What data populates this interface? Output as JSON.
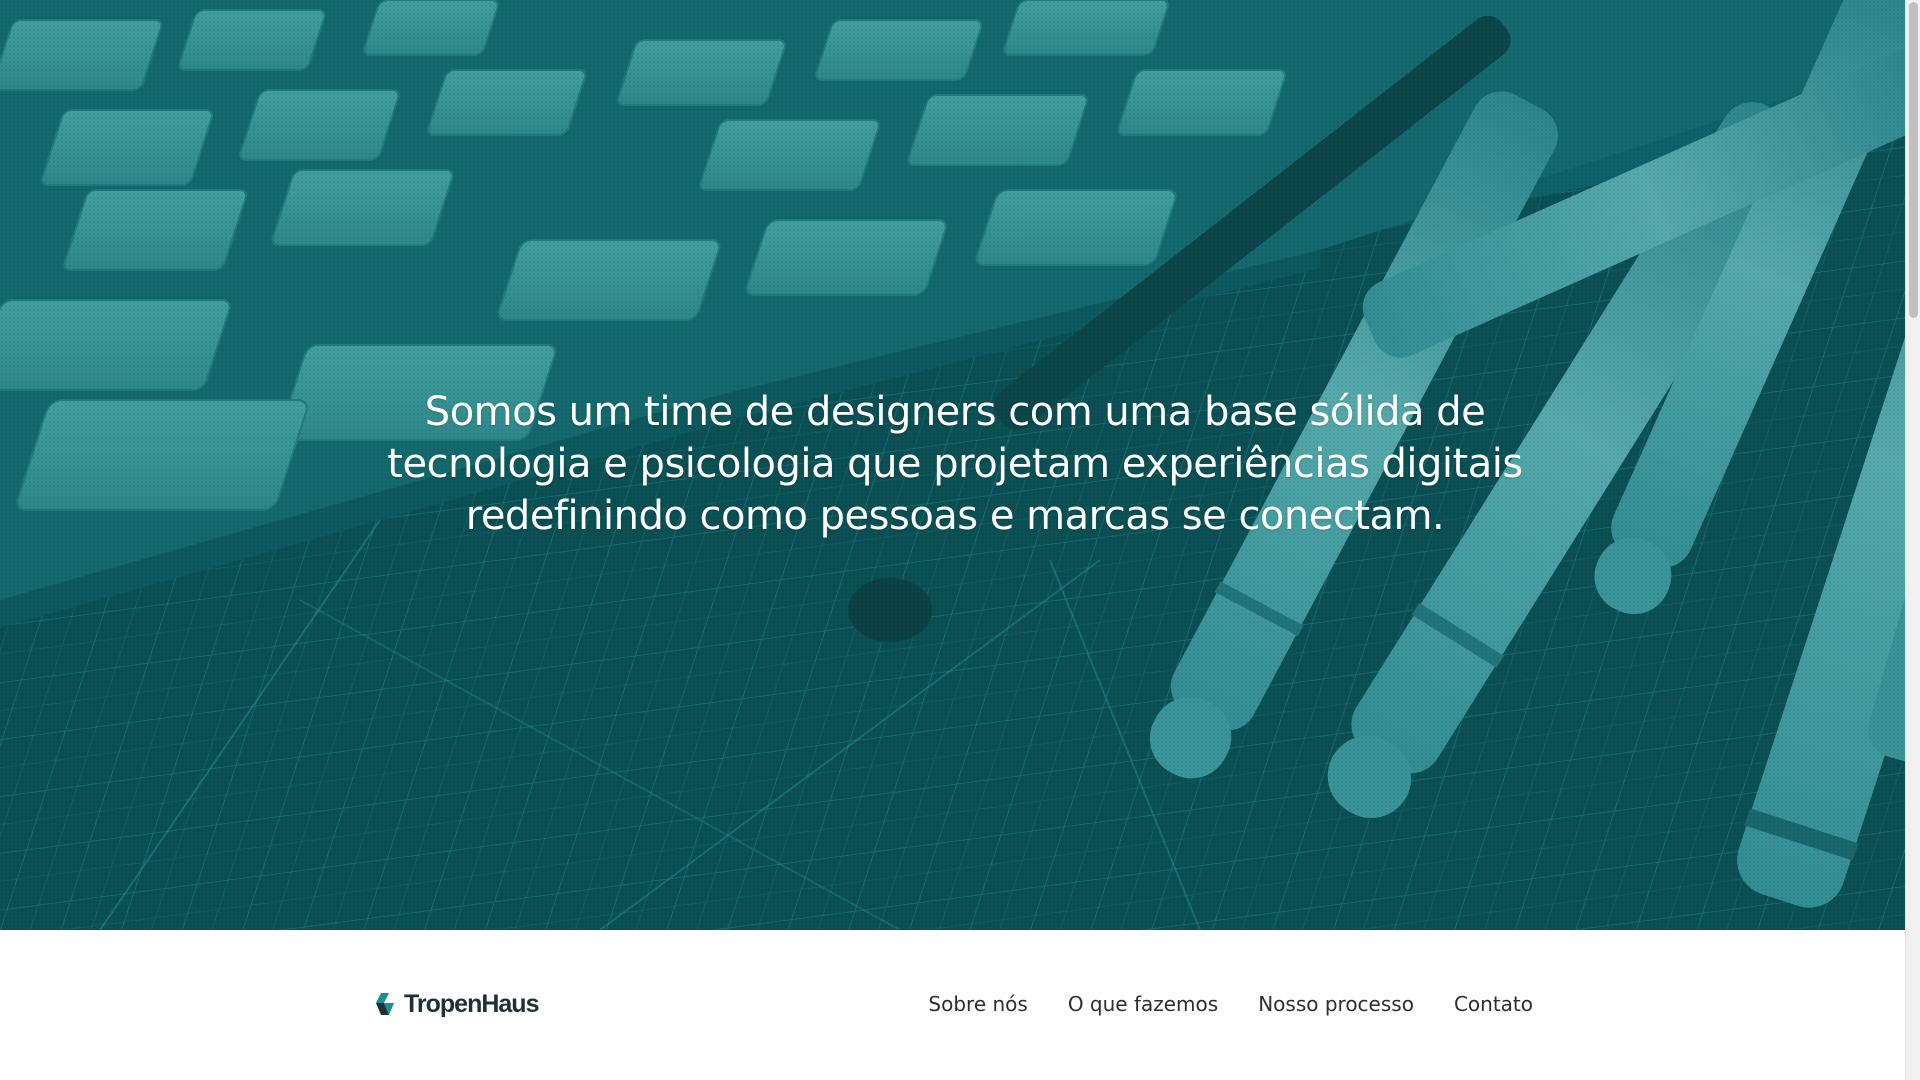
{
  "hero": {
    "headline": "Somos um time de designers com uma base sólida de tecnologia e psicologia que projetam experiências digitais redefinindo como pessoas e marcas se conectam.",
    "overlay_color": "#0d5d63"
  },
  "header": {
    "logo_text": "TropenHaus",
    "logo_icon": "tropenhaus-logo-icon",
    "nav": [
      {
        "label": "Sobre nós"
      },
      {
        "label": "O que fazemos"
      },
      {
        "label": "Nosso processo"
      },
      {
        "label": "Contato"
      }
    ]
  },
  "colors": {
    "accent": "#1a8f9a",
    "brand_text": "#1f3138",
    "nav_text": "#2e2e2e"
  }
}
